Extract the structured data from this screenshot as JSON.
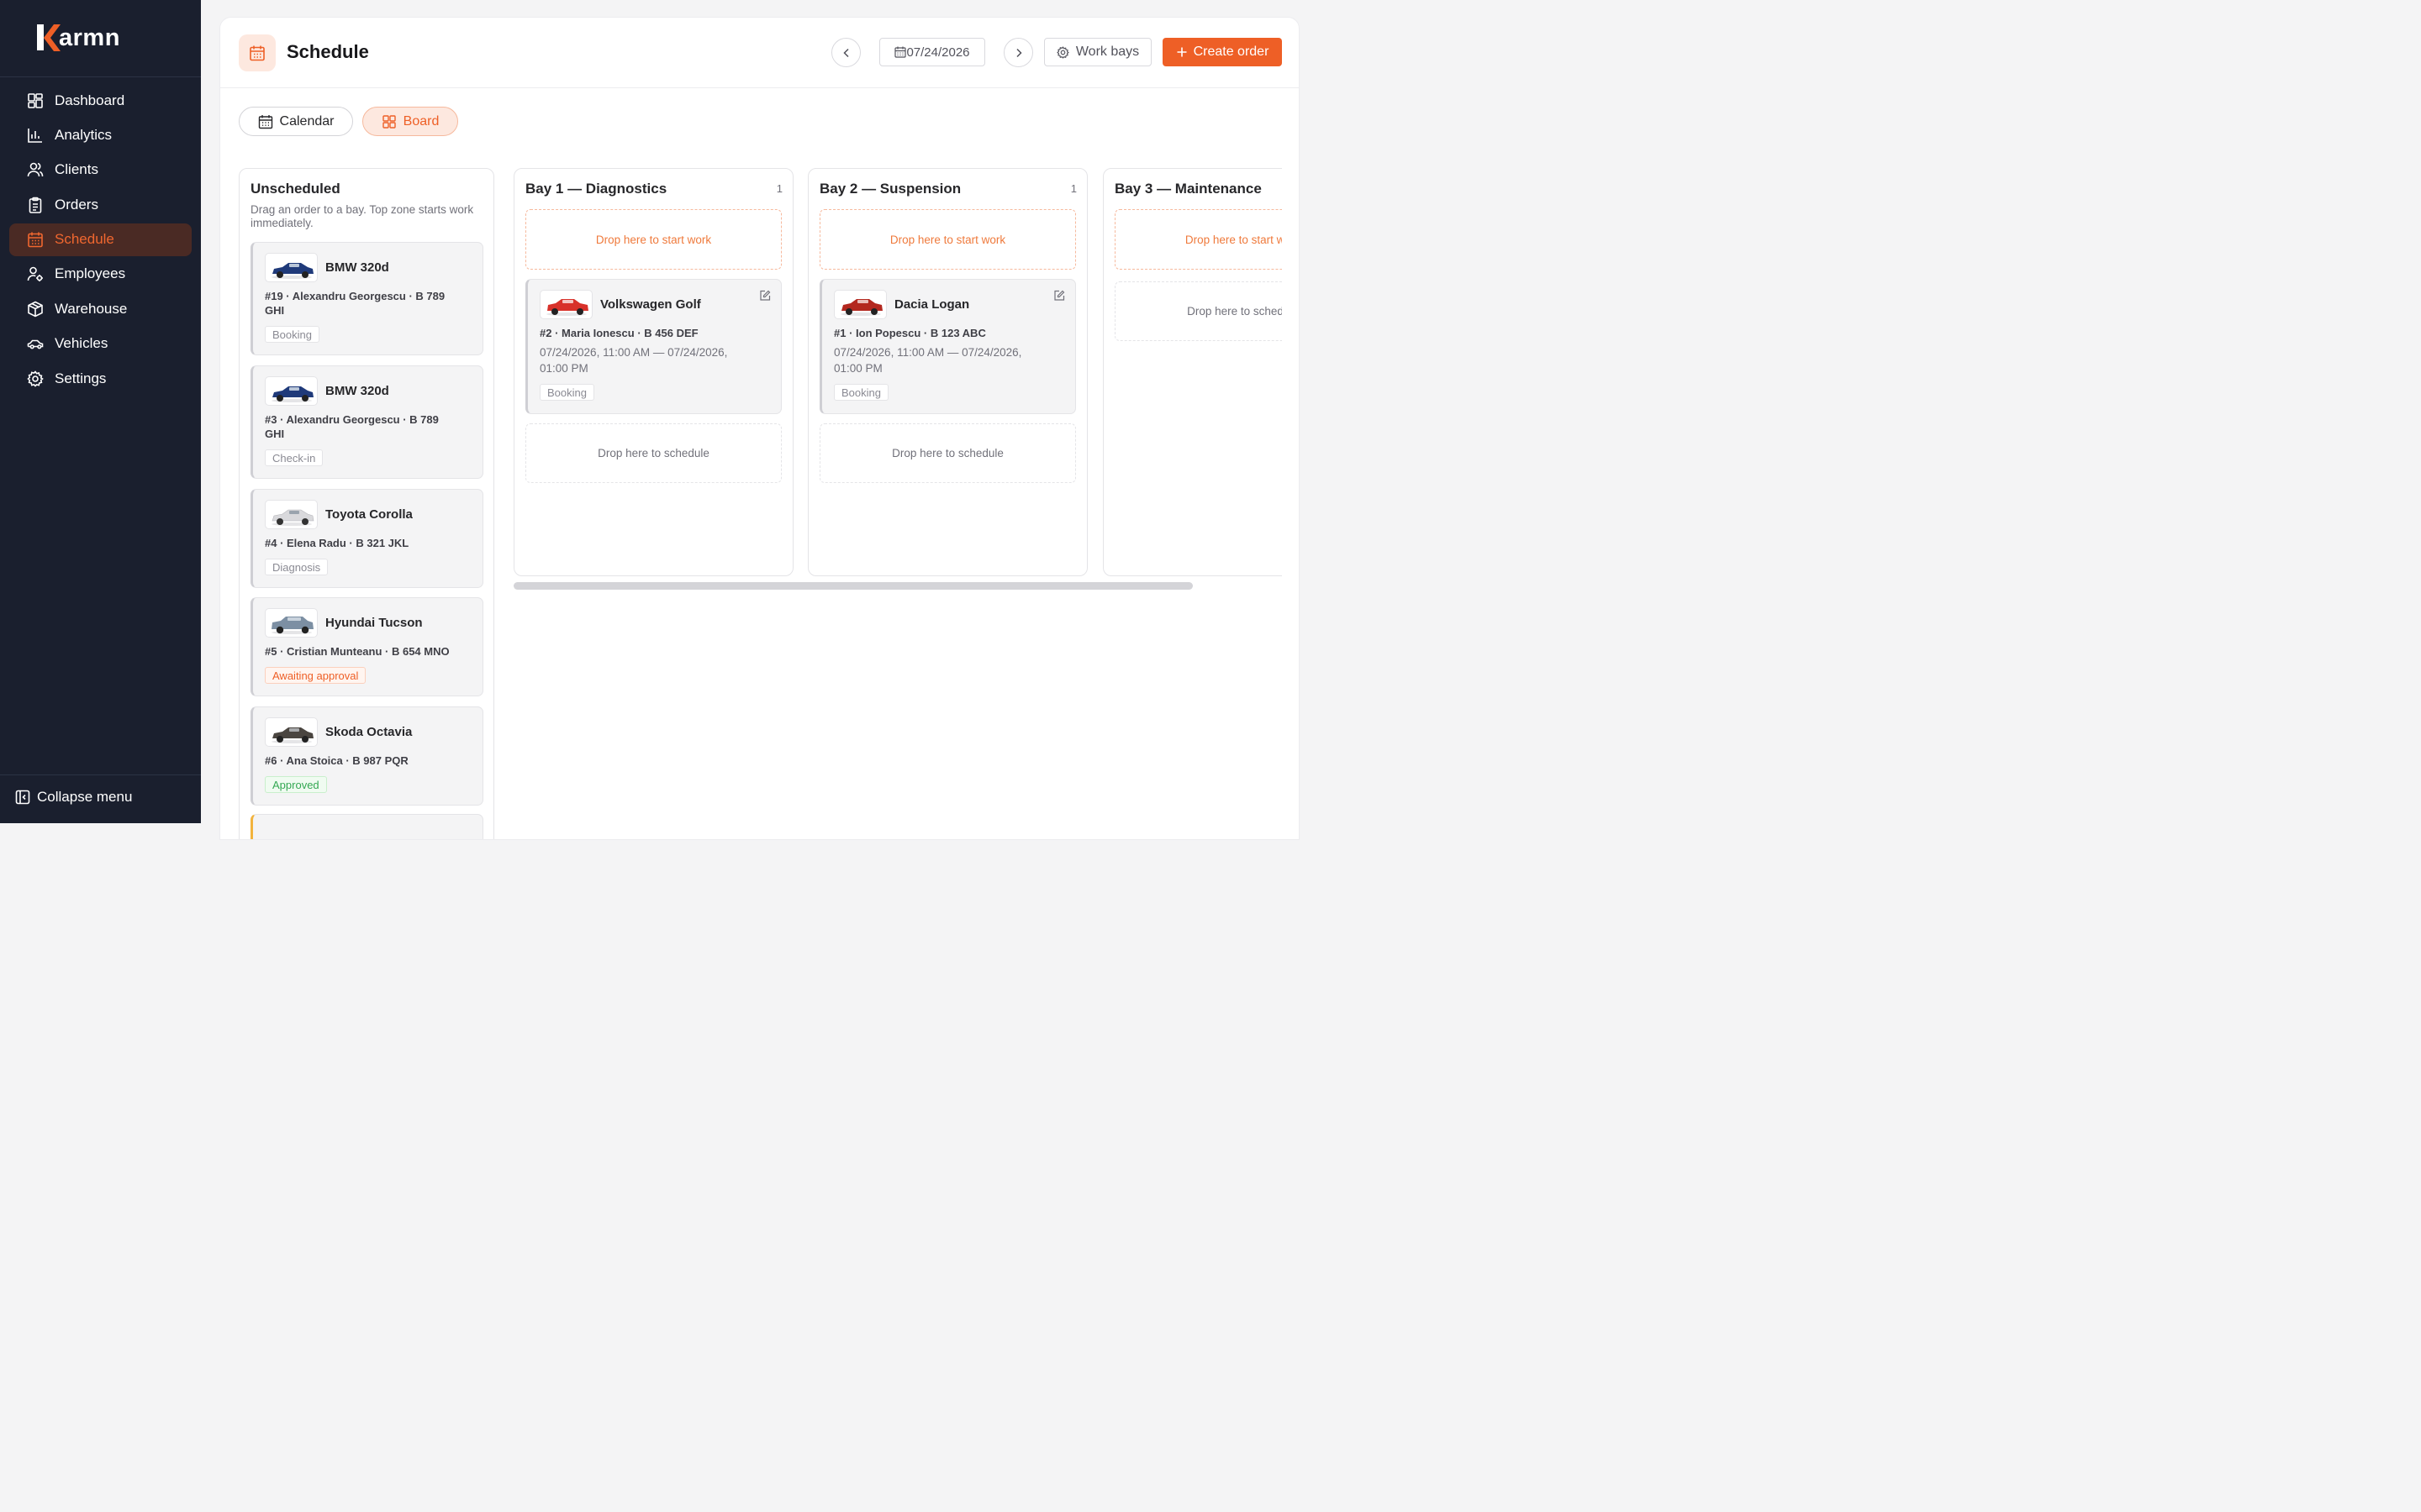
{
  "brand": {
    "name": "armn",
    "accent": "#ee5f26"
  },
  "sidebar": {
    "items": [
      {
        "label": "Dashboard",
        "icon": "dashboard-icon"
      },
      {
        "label": "Analytics",
        "icon": "bar-chart-icon"
      },
      {
        "label": "Clients",
        "icon": "users-icon"
      },
      {
        "label": "Orders",
        "icon": "clipboard-icon"
      },
      {
        "label": "Schedule",
        "icon": "calendar-icon",
        "active": true
      },
      {
        "label": "Employees",
        "icon": "user-gear-icon"
      },
      {
        "label": "Warehouse",
        "icon": "box-icon"
      },
      {
        "label": "Vehicles",
        "icon": "car-icon"
      },
      {
        "label": "Settings",
        "icon": "gear-icon"
      }
    ],
    "collapse_label": "Collapse menu"
  },
  "header": {
    "title": "Schedule",
    "date": "07/24/2026",
    "work_bays_label": "Work bays",
    "create_label": "Create order"
  },
  "views": {
    "calendar_label": "Calendar",
    "board_label": "Board",
    "active": "Board"
  },
  "unscheduled": {
    "title": "Unscheduled",
    "description": "Drag an order to a bay. Top zone starts work immediately.",
    "cards": [
      {
        "car": "BMW 320d",
        "car_color": "#1f3a7a",
        "line": "#19 · Alexandru Georgescu · B 789 GHI",
        "status": "Booking",
        "status_type": "default"
      },
      {
        "car": "BMW 320d",
        "car_color": "#1f3a7a",
        "line": "#3 · Alexandru Georgescu · B 789 GHI",
        "status": "Check-in",
        "status_type": "default"
      },
      {
        "car": "Toyota Corolla",
        "car_color": "#d9d9dc",
        "line": "#4 · Elena Radu · B 321 JKL",
        "status": "Diagnosis",
        "status_type": "default"
      },
      {
        "car": "Hyundai Tucson",
        "car_color": "#7c8fa3",
        "line": "#5 · Cristian Munteanu · B 654 MNO",
        "status": "Awaiting approval",
        "status_type": "warn"
      },
      {
        "car": "Skoda Octavia",
        "car_color": "#4a4540",
        "line": "#6 · Ana Stoica · B 987 PQR",
        "status": "Approved",
        "status_type": "ok"
      }
    ]
  },
  "bays": [
    {
      "title": "Bay 1 — Diagnostics",
      "count": "1",
      "drop_start": "Drop here to start work",
      "drop_schedule": "Drop here to schedule",
      "card": {
        "car": "Volkswagen Golf",
        "car_color": "#d8312a",
        "line": "#2 · Maria Ionescu · B 456 DEF",
        "time": "07/24/2026, 11:00 AM — 07/24/2026, 01:00 PM",
        "status": "Booking"
      }
    },
    {
      "title": "Bay 2 — Suspension",
      "count": "1",
      "drop_start": "Drop here to start work",
      "drop_schedule": "Drop here to schedule",
      "card": {
        "car": "Dacia Logan",
        "car_color": "#b3281f",
        "line": "#1 · Ion Popescu · B 123 ABC",
        "time": "07/24/2026, 11:00 AM — 07/24/2026, 01:00 PM",
        "status": "Booking"
      }
    },
    {
      "title": "Bay 3 — Maintenance",
      "count": "",
      "drop_start": "Drop here to start work",
      "drop_schedule": "Drop here to schedule"
    }
  ]
}
